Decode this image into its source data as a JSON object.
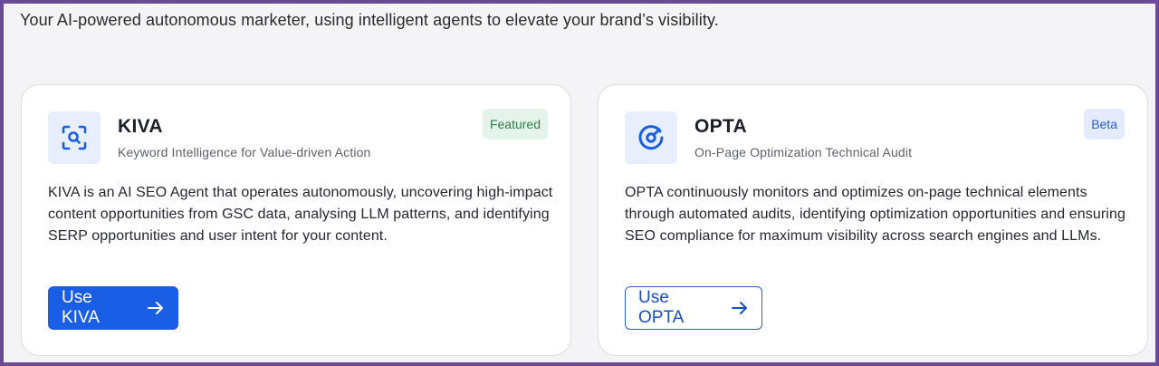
{
  "tagline": "Your AI-powered autonomous marketer, using intelligent agents to elevate your brand’s visibility.",
  "colors": {
    "frame": "#6b4a96",
    "primary": "#1a5ee5",
    "featured_bg": "#e5f4ea",
    "beta_bg": "#e3ebfc"
  },
  "cards": [
    {
      "icon": "search-scan-icon",
      "title": "KIVA",
      "subtitle": "Keyword Intelligence for Value-driven Action",
      "badge": "Featured",
      "description": "KIVA is an AI SEO Agent that operates autonomously, uncovering high-impact content opportunities from GSC data, analysing LLM patterns, and identifying SERP opportunities and user intent for your content.",
      "cta": "Use KIVA"
    },
    {
      "icon": "gauge-icon",
      "title": "OPTA",
      "subtitle": "On-Page Optimization Technical Audit",
      "badge": "Beta",
      "description": "OPTA continuously monitors and optimizes on-page technical elements through automated audits, identifying optimization opportunities and ensuring SEO compliance for maximum visibility across search engines and LLMs.",
      "cta": "Use OPTA"
    }
  ]
}
